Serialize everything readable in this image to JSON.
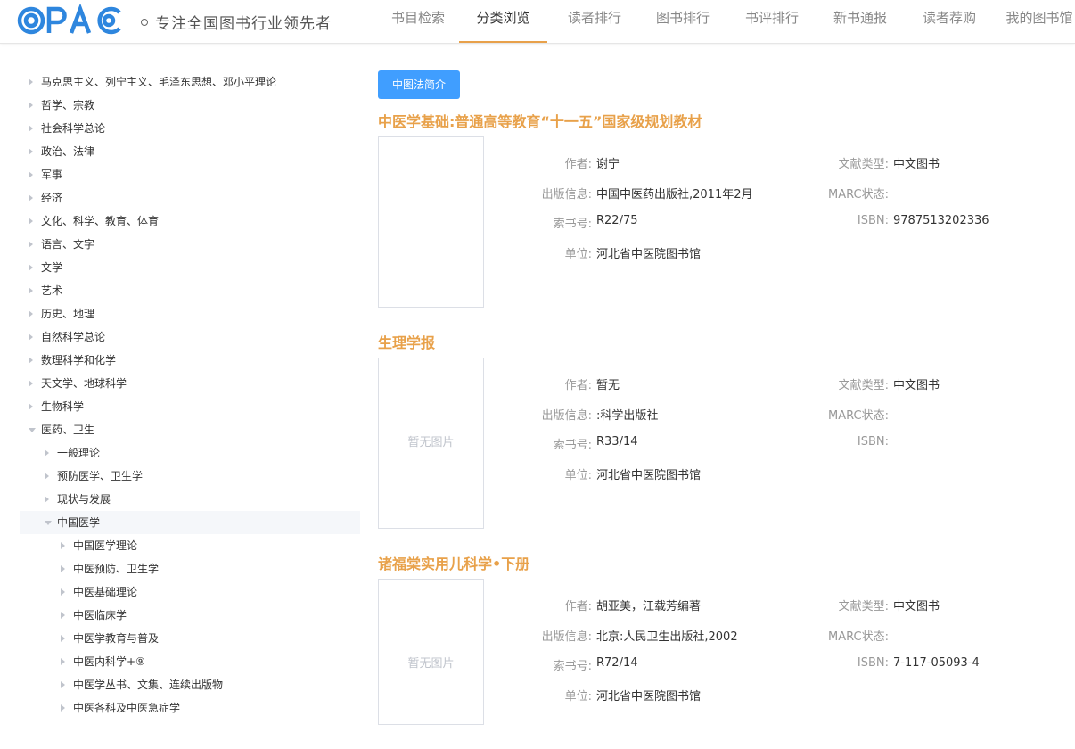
{
  "header": {
    "slogan": "专注全国图书行业领先者",
    "nav": [
      {
        "label": "书目检索",
        "active": false
      },
      {
        "label": "分类浏览",
        "active": true
      },
      {
        "label": "读者排行",
        "active": false
      },
      {
        "label": "图书排行",
        "active": false
      },
      {
        "label": "书评排行",
        "active": false
      },
      {
        "label": "新书通报",
        "active": false
      },
      {
        "label": "读者荐购",
        "active": false
      },
      {
        "label": "我的图书馆",
        "active": false
      }
    ]
  },
  "tree": [
    {
      "label": "马克思主义、列宁主义、毛泽东思想、邓小平理论",
      "level": 0,
      "open": false
    },
    {
      "label": "哲学、宗教",
      "level": 0,
      "open": false
    },
    {
      "label": "社会科学总论",
      "level": 0,
      "open": false
    },
    {
      "label": "政治、法律",
      "level": 0,
      "open": false
    },
    {
      "label": "军事",
      "level": 0,
      "open": false
    },
    {
      "label": "经济",
      "level": 0,
      "open": false
    },
    {
      "label": "文化、科学、教育、体育",
      "level": 0,
      "open": false
    },
    {
      "label": "语言、文字",
      "level": 0,
      "open": false
    },
    {
      "label": "文学",
      "level": 0,
      "open": false
    },
    {
      "label": "艺术",
      "level": 0,
      "open": false
    },
    {
      "label": "历史、地理",
      "level": 0,
      "open": false
    },
    {
      "label": "自然科学总论",
      "level": 0,
      "open": false
    },
    {
      "label": "数理科学和化学",
      "level": 0,
      "open": false
    },
    {
      "label": "天文学、地球科学",
      "level": 0,
      "open": false
    },
    {
      "label": "生物科学",
      "level": 0,
      "open": false
    },
    {
      "label": "医药、卫生",
      "level": 0,
      "open": true
    },
    {
      "label": "一般理论",
      "level": 1,
      "open": false
    },
    {
      "label": "预防医学、卫生学",
      "level": 1,
      "open": false
    },
    {
      "label": "现状与发展",
      "level": 1,
      "open": false
    },
    {
      "label": "中国医学",
      "level": 1,
      "open": true,
      "selected": true
    },
    {
      "label": "中国医学理论",
      "level": 2,
      "open": false
    },
    {
      "label": "中医预防、卫生学",
      "level": 2,
      "open": false
    },
    {
      "label": "中医基础理论",
      "level": 2,
      "open": false
    },
    {
      "label": "中医临床学",
      "level": 2,
      "open": false
    },
    {
      "label": "中医学教育与普及",
      "level": 2,
      "open": false
    },
    {
      "label": "中医内科学+⑨",
      "level": 2,
      "open": false
    },
    {
      "label": "中医学丛书、文集、连续出版物",
      "level": 2,
      "open": false
    },
    {
      "label": "中医各科及中医急症学",
      "level": 2,
      "open": false
    }
  ],
  "main": {
    "intro_button": "中图法简介",
    "labels": {
      "author": "作者:",
      "publisher": "出版信息:",
      "call_number": "索书号:",
      "unit": "单位:",
      "doc_type": "文献类型:",
      "marc": "MARC状态:",
      "isbn": "ISBN:"
    },
    "books": [
      {
        "title": "中医学基础:普通高等教育“十一五”国家级规划教材",
        "cover_text": "",
        "author": "谢宁",
        "publisher": "中国中医药出版社,2011年2月",
        "call_number": "R22/75",
        "unit": "河北省中医院图书馆",
        "doc_type": "中文图书",
        "marc": "",
        "isbn": "9787513202336"
      },
      {
        "title": "生理学报",
        "cover_text": "暂无图片",
        "author": "暂无",
        "publisher": ":科学出版社",
        "call_number": "R33/14",
        "unit": "河北省中医院图书馆",
        "doc_type": "中文图书",
        "marc": "",
        "isbn": ""
      },
      {
        "title": "诸福棠实用儿科学•下册",
        "cover_text": "暂无图片",
        "author": "胡亚美，江载芳编著",
        "publisher": "北京:人民卫生出版社,2002",
        "call_number": "R72/14",
        "unit": "河北省中医院图书馆",
        "doc_type": "中文图书",
        "marc": "",
        "isbn": "7-117-05093-4"
      }
    ]
  },
  "colors": {
    "accent": "#e8a14a",
    "primary_button": "#409eff",
    "logo_blue": "#2e86de"
  }
}
